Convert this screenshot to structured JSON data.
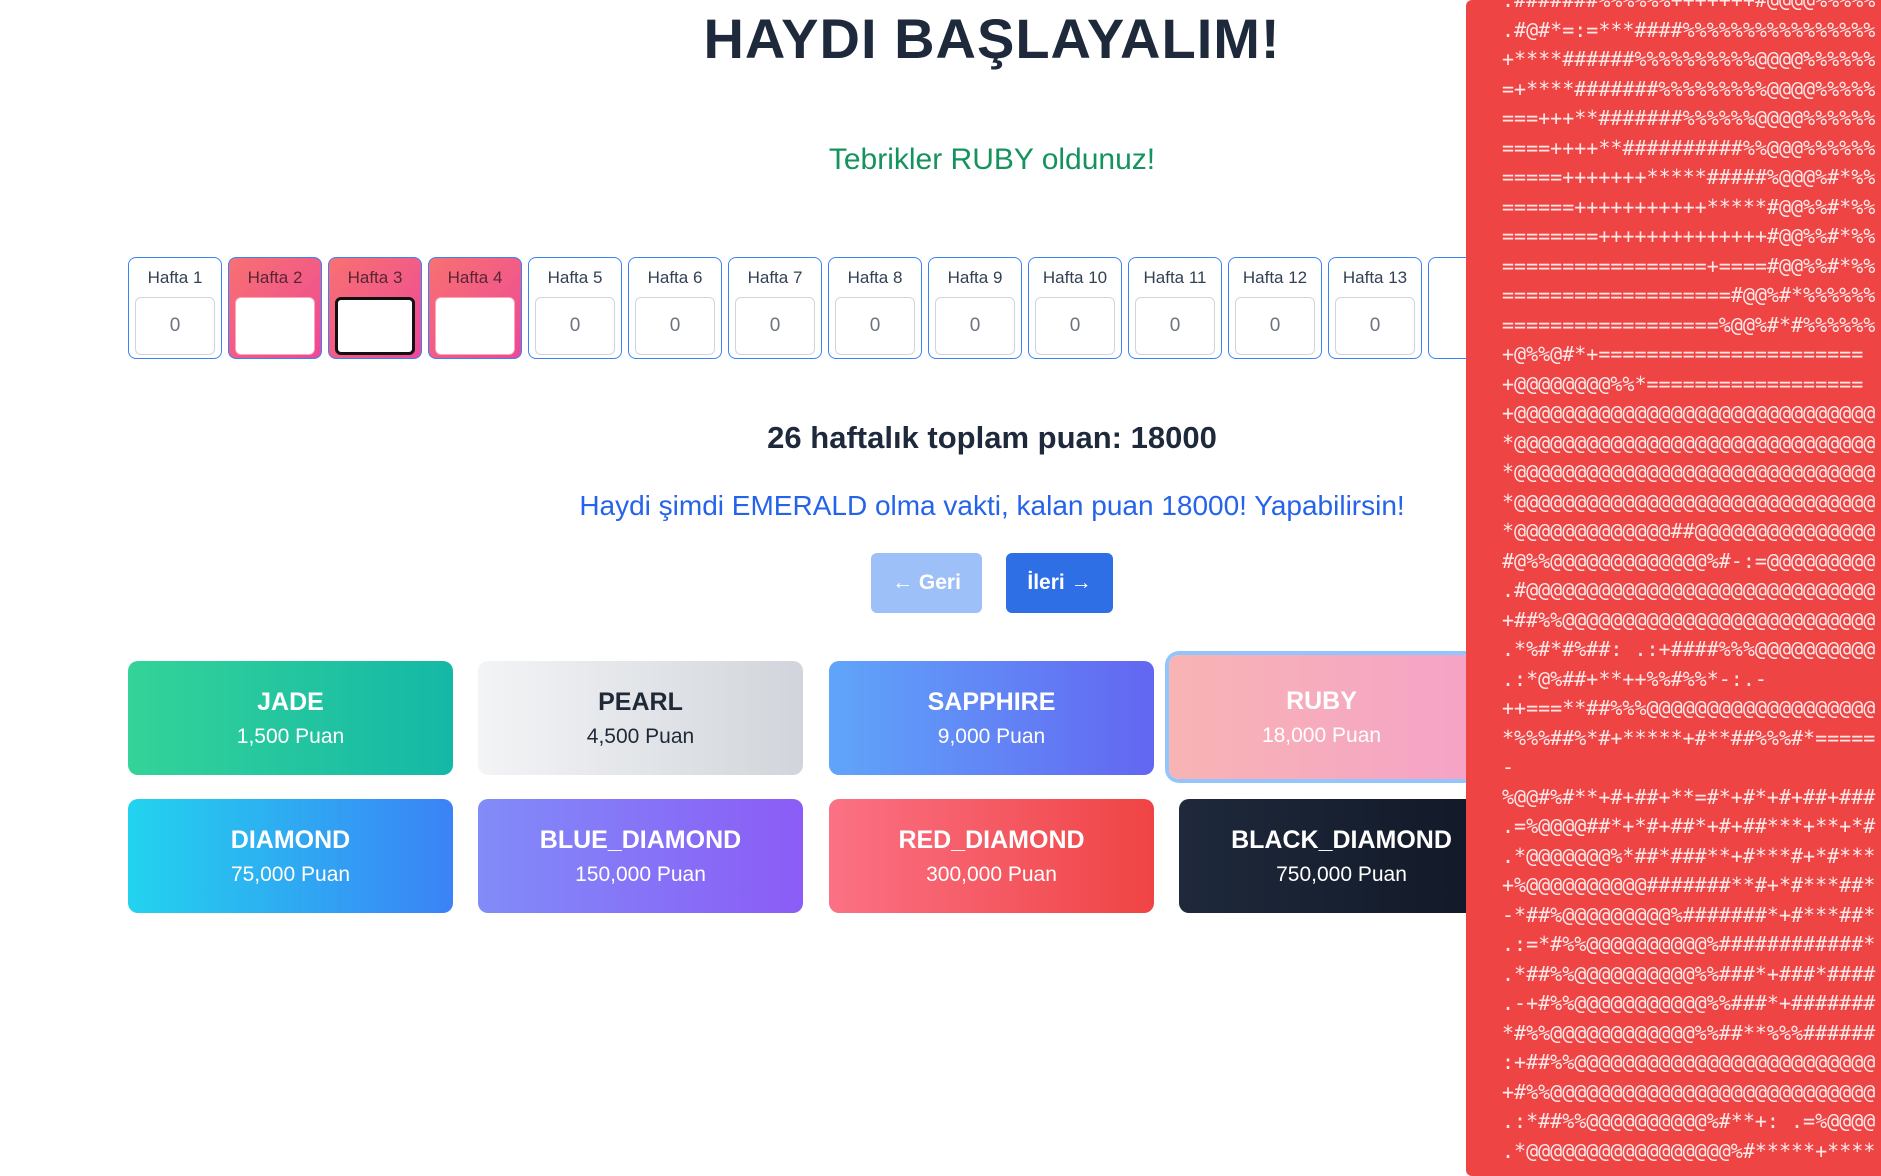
{
  "page": {
    "title": "HAYDI BAŞLAYALIM!",
    "congrats": "Tebrikler RUBY oldunuz!",
    "total": "26 haftalık toplam puan: 18000",
    "motivation": "Haydi şimdi EMERALD olma vakti, kalan puan 18000! Yapabilirsin!"
  },
  "weeks": [
    {
      "label": "Hafta 1",
      "value": "0"
    },
    {
      "label": "Hafta 2",
      "value": ""
    },
    {
      "label": "Hafta 3",
      "value": ""
    },
    {
      "label": "Hafta 4",
      "value": ""
    },
    {
      "label": "Hafta 5",
      "value": "0"
    },
    {
      "label": "Hafta 6",
      "value": "0"
    },
    {
      "label": "Hafta 7",
      "value": "0"
    },
    {
      "label": "Hafta 8",
      "value": "0"
    },
    {
      "label": "Hafta 9",
      "value": "0"
    },
    {
      "label": "Hafta 10",
      "value": "0"
    },
    {
      "label": "Hafta 11",
      "value": "0"
    },
    {
      "label": "Hafta 12",
      "value": "0"
    },
    {
      "label": "Hafta 13",
      "value": "0"
    }
  ],
  "nav": {
    "back": "← Geri",
    "next": "İleri →"
  },
  "tiers": [
    {
      "name": "JADE",
      "points": "1,500 Puan",
      "colors": [
        "#34d399",
        "#14b8a6"
      ],
      "text": "#ffffff"
    },
    {
      "name": "PEARL",
      "points": "4,500 Puan",
      "colors": [
        "#f3f4f6",
        "#d1d5db"
      ],
      "text": "#1f2937"
    },
    {
      "name": "SAPPHIRE",
      "points": "9,000 Puan",
      "colors": [
        "#60a5fa",
        "#6366f1"
      ],
      "text": "#ffffff"
    },
    {
      "name": "RUBY",
      "points": "18,000 Puan",
      "colors": [
        "#f8b4b4",
        "#f5a3c7"
      ],
      "text": "#ffffff",
      "selected": true
    },
    {
      "name": "DIAMOND",
      "points": "75,000 Puan",
      "colors": [
        "#22d3ee",
        "#3b82f6"
      ],
      "text": "#ffffff"
    },
    {
      "name": "BLUE_DIAMOND",
      "points": "150,000 Puan",
      "colors": [
        "#818cf8",
        "#8b5cf6"
      ],
      "text": "#ffffff"
    },
    {
      "name": "RED_DIAMOND",
      "points": "300,000 Puan",
      "colors": [
        "#fb7185",
        "#ef4444"
      ],
      "text": "#ffffff"
    },
    {
      "name": "BLACK_DIAMOND",
      "points": "750,000 Puan",
      "colors": [
        "#1e293b",
        "#111827"
      ],
      "text": "#ffffff"
    }
  ],
  "side_panel": {
    "bg_color": "#ef4444",
    "ascii_art": ".#######%%%%%%+++++++#@@@@%%%%%\n.#@#*=:=***####%%%%%%%%%%%%%%%%\n+****######%%%%%%%%%%@@@@%%%%%%\n=+****#######%%%%%%%%%@@@@%%%%%\n===+++**#######%%%%%%@@@@%%%%%%\n====++++**##########%%@@@%%%%%%\n=====+++++++*****#####%@@@%#*%%\n======+++++++++++*****#@@%%#*%%\n========++++++++++++++#@@%%#*%%\n=================+====#@@%%#*%%\n===================#@@%#*%%%%%%\n==================%@@%#*#%%%%%%\n+@%%@#*+======================\n+@@@@@@@@%%*==================\n+@@@@@@@@@@@@@@@@@@@@@@@@@@@@@@\n*@@@@@@@@@@@@@@@@@@@@@@@@@@@@@@\n*@@@@@@@@@@@@@@@@@@@@@@@@@@@@@@\n*@@@@@@@@@@@@@@@@@@@@@@@@@@@@@@\n*@@@@@@@@@@@@@##@@@@@@@@@@@@@@@\n#@%%@@@@@@@@@@@@@%#-:=@@@@@@@@@\n.#@@@@@@@@@@@@@@@@@@@@@@@@@@@@@\n+##%%@@@@@@@@@@@@@@@@@@@@@@@@@@\n.*%#*#%##: .:+####%%%@@@@@@@@@@\n.:*@%##+**++%%#%%*-:.-\n++===**##%%%@@@@@@@@@@@@@@@@@@@\n*%%%##%*#+*****+#**##%%%#*=====\n-\n%@@#%#**+#+##+**=#*+#*+#+##+###\n.=%@@@@##*+*#+##*+#+##***+**+*#\n.*@@@@@@@%*##*###**+#***#+*#***\n+%@@@@@@@@@@#######**#+*#***##*\n-*##%@@@@@@@@@%#######*+#***##*\n.:=*#%%@@@@@@@@@@%############*\n.*##%%@@@@@@@@@@%%###*+###*####\n.-+#%%@@@@@@@@@@@%%###*+#######\n*#%%@@@@@@@@@@@@%%##**%%%######\n:+##%%@@@@@@@@@@@@@@@@@@@@@@@@@\n+#%%@@@@@@@@@@@@@@@@@@@@@@@@@@@\n.:*##%%@@@@@@@@@@%#**+: .=%@@@@\n.*@@@@@@@@@@@@@@@@@%#*****+****"
  }
}
